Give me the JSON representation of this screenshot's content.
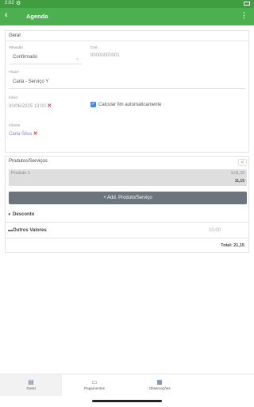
{
  "status": {
    "time": "2:02"
  },
  "app_bar": {
    "title": "Agenda",
    "back_label": "‹",
    "menu_label": "⋮"
  },
  "geral": {
    "section_title": "Geral",
    "situacao": {
      "label": "Situação",
      "value": "Confirmado"
    },
    "cod": {
      "label": "Cod.",
      "value": "00000000001"
    },
    "titulo": {
      "label": "Título*",
      "value": "Carla - Serviço Y"
    },
    "inicio": {
      "label": "Início",
      "value": "30/06/2025 13:00"
    },
    "calcular": {
      "label": "Calcular fim automaticamente",
      "checked": true
    },
    "cliente": {
      "label": "Cliente",
      "value": "Carla Silva"
    }
  },
  "produtos": {
    "section_title": "Produtos/Serviços",
    "items": [
      {
        "name": "Produto 1",
        "qty": "1x11,15",
        "total": "11,15"
      }
    ],
    "add_button": "+ Add. Produto/Serviço",
    "desconto_label": "Desconto",
    "outros_label": "Outros Valores",
    "outros_value": "10,00",
    "total_label": "Total: 21,15"
  },
  "bottom_nav": [
    {
      "label": "Geral",
      "active": true
    },
    {
      "label": "Pagamentos",
      "active": false
    },
    {
      "label": "Observações",
      "active": false
    }
  ],
  "colors": {
    "primary": "#4caf50",
    "status_bar": "#3f9e3f",
    "button": "#6c757d",
    "link": "#8f7bd6",
    "error": "#e53935"
  }
}
